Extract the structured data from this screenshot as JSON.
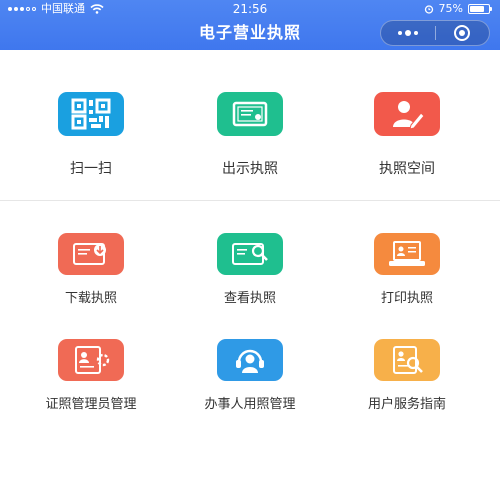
{
  "status_bar": {
    "carrier": "中国联通",
    "time": "21:56",
    "battery_text": "75%",
    "battery_level": 0.75
  },
  "nav": {
    "title": "电子营业执照"
  },
  "main_actions": [
    {
      "label": "扫一扫",
      "icon": "qr-code-icon",
      "color": "#1aa0e0"
    },
    {
      "label": "出示执照",
      "icon": "certificate-icon",
      "color": "#1fbf8f"
    },
    {
      "label": "执照空间",
      "icon": "user-pen-icon",
      "color": "#f2594b"
    }
  ],
  "features": [
    {
      "label": "下载执照",
      "icon": "download-license-icon",
      "color": "#f06a55"
    },
    {
      "label": "查看执照",
      "icon": "view-license-icon",
      "color": "#1fbf8f"
    },
    {
      "label": "打印执照",
      "icon": "print-license-icon",
      "color": "#f58a3e"
    },
    {
      "label": "证照管理员管理",
      "icon": "admin-manage-icon",
      "color": "#f06a55"
    },
    {
      "label": "办事人用照管理",
      "icon": "agent-manage-icon",
      "color": "#2f9ae6"
    },
    {
      "label": "用户服务指南",
      "icon": "service-guide-icon",
      "color": "#f7b04a"
    }
  ]
}
